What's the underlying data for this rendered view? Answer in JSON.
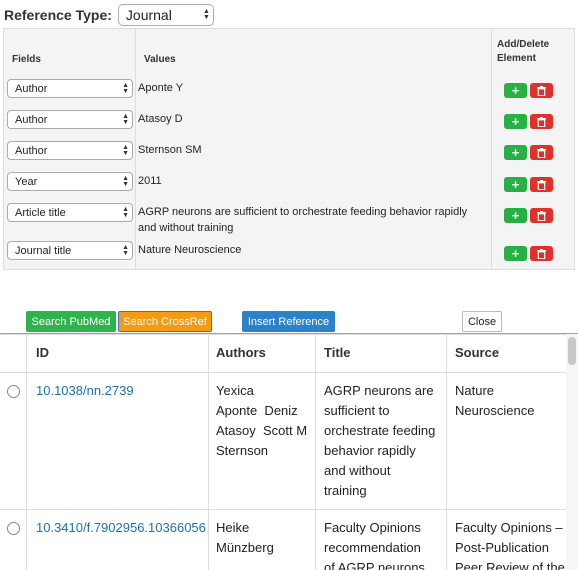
{
  "reference_type": {
    "label": "Reference Type:",
    "value": "Journal"
  },
  "fields_table": {
    "headers": {
      "fields": "Fields",
      "values": "Values",
      "actions_line1": "Add/Delete",
      "actions_line2": "Element"
    },
    "rows": [
      {
        "field": "Author",
        "value": "Aponte Y"
      },
      {
        "field": "Author",
        "value": "Atasoy D"
      },
      {
        "field": "Author",
        "value": "Sternson SM"
      },
      {
        "field": "Year",
        "value": "2011"
      },
      {
        "field": "Article title",
        "value": "AGRP neurons are sufficient to orchestrate feeding behavior rapidly and without training"
      },
      {
        "field": "Journal title",
        "value": "Nature Neuroscience"
      }
    ],
    "add_symbol": "+",
    "colors": {
      "add": "#27b043",
      "delete": "#e0302a"
    }
  },
  "actions": {
    "search_pubmed": "Search PubMed",
    "search_crossref": "Search CrossRef",
    "insert_reference": "Insert Reference",
    "close": "Close",
    "colors": {
      "pubmed": "#2fb34c",
      "crossref": "#f39b13",
      "insert": "#2b82c9"
    }
  },
  "results": {
    "headers": {
      "id": "ID",
      "authors": "Authors",
      "title": "Title",
      "source": "Source"
    },
    "rows": [
      {
        "id": "10.1038/nn.2739",
        "authors": [
          "Yexica",
          "Aponte  Deniz",
          "Atasoy  Scott M",
          "Sternson"
        ],
        "title": [
          "AGRP neurons are",
          "sufficient to",
          "orchestrate feeding",
          "behavior rapidly",
          "and without",
          "training"
        ],
        "source": [
          "Nature",
          "Neuroscience"
        ]
      },
      {
        "id": "10.3410/f.7902956.10366056",
        "authors": [
          "Heike",
          "Münzberg"
        ],
        "title": [
          "Faculty Opinions",
          "recommendation",
          "of AGRP neurons"
        ],
        "source": [
          "Faculty Opinions –",
          "Post-Publication",
          "Peer Review of the"
        ]
      }
    ]
  }
}
